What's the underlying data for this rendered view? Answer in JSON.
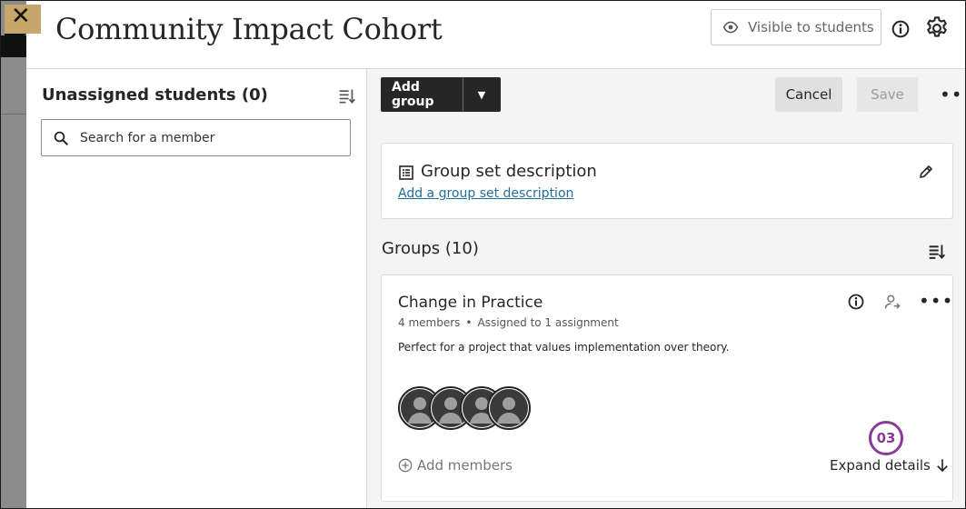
{
  "header": {
    "close_icon": "close-icon",
    "title": "Community Impact Cohort",
    "visibility_label": "Visible to students"
  },
  "left_panel": {
    "unassigned_title": "Unassigned students (0)",
    "search_placeholder": "Search for a member"
  },
  "toolbar": {
    "add_group_label": "Add group",
    "cancel_label": "Cancel",
    "save_label": "Save",
    "more_label": "•••"
  },
  "description_card": {
    "title": "Group set description",
    "link_label": "Add a group set description"
  },
  "groups": {
    "title": "Groups (10)",
    "items": [
      {
        "name": "Change in Practice",
        "members_count": "4 members",
        "separator": "•",
        "assignment": "Assigned to 1 assignment",
        "description": "Perfect for a project that values implementation over theory.",
        "more_label": "•••",
        "add_members_label": "Add members",
        "expand_label": "Expand details",
        "avatar_count": 4
      }
    ]
  },
  "callout": {
    "label": "03"
  },
  "colors": {
    "accent_gold": "#c7a66b",
    "dark_button": "#262626",
    "link_blue": "#1f6f9a",
    "callout_purple": "#8a3a9a",
    "panel_gray": "#f4f4f4"
  }
}
